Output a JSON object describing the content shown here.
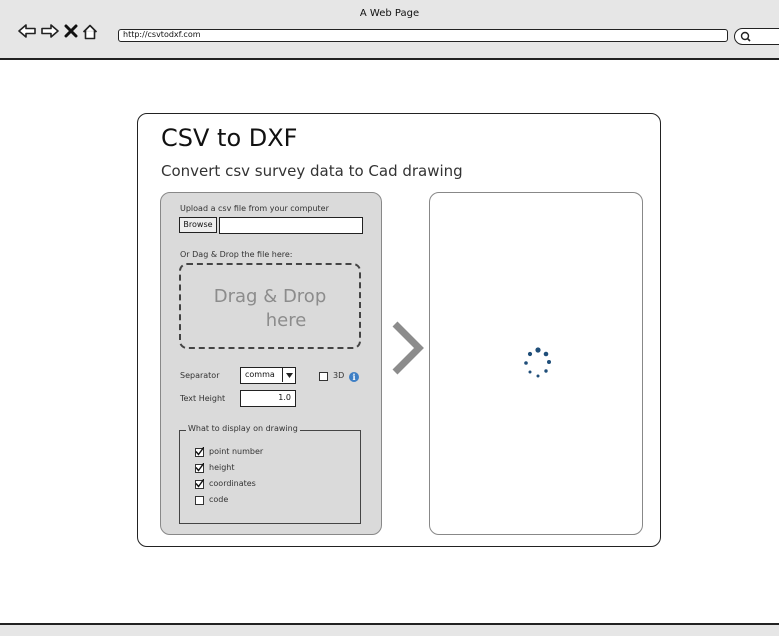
{
  "browser": {
    "window_title": "A Web Page",
    "url": "http://csvtodxf.com"
  },
  "page": {
    "title": "CSV to DXF",
    "subtitle": "Convert csv survey data to Cad drawing"
  },
  "upload": {
    "label": "Upload a csv file from your computer",
    "browse_label": "Browse",
    "file_value": "",
    "dragdrop_label": "Or Dag & Drop the file here:",
    "dropzone_line1": "Drag & Drop",
    "dropzone_line2": "here"
  },
  "options": {
    "separator_label": "Separator",
    "separator_value": "comma",
    "threed_label": "3D",
    "threed_checked": false,
    "text_height_label": "Text Height",
    "text_height_value": "1.0"
  },
  "display": {
    "legend": "What to display on drawing",
    "items": [
      {
        "label": "point number",
        "checked": true
      },
      {
        "label": "height",
        "checked": true
      },
      {
        "label": "coordinates",
        "checked": true
      },
      {
        "label": "code",
        "checked": false
      }
    ]
  },
  "colors": {
    "panel_bg": "#dadada",
    "spinner": "#1f4e79",
    "info": "#3e7fc5"
  }
}
